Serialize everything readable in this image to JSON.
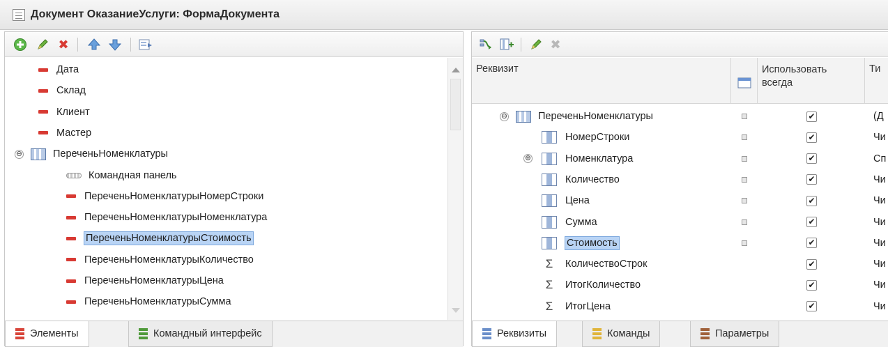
{
  "window": {
    "title": "Документ ОказаниеУслуги: ФормаДокумента"
  },
  "left": {
    "toolbar": [
      "add-icon",
      "edit-icon",
      "delete-icon",
      "move-up-icon",
      "move-down-icon",
      "form-icon"
    ],
    "items": [
      {
        "label": "Дата",
        "kind": "field",
        "level": 1
      },
      {
        "label": "Склад",
        "kind": "field",
        "level": 1
      },
      {
        "label": "Клиент",
        "kind": "field",
        "level": 1
      },
      {
        "label": "Мастер",
        "kind": "field",
        "level": 1
      },
      {
        "label": "ПереченьНоменклатуры",
        "kind": "table",
        "level": 0,
        "expander": "⊖"
      },
      {
        "label": "Командная панель",
        "kind": "command",
        "level": 2
      },
      {
        "label": "ПереченьНоменклатурыНомерСтроки",
        "kind": "field",
        "level": 2
      },
      {
        "label": "ПереченьНоменклатурыНоменклатура",
        "kind": "field",
        "level": 2
      },
      {
        "label": "ПереченьНоменклатурыСтоимость",
        "kind": "field",
        "level": 2,
        "selected": true
      },
      {
        "label": "ПереченьНоменклатурыКоличество",
        "kind": "field",
        "level": 2
      },
      {
        "label": "ПереченьНоменклатурыЦена",
        "kind": "field",
        "level": 2
      },
      {
        "label": "ПереченьНоменклатурыСумма",
        "kind": "field",
        "level": 2
      }
    ],
    "tabs": [
      {
        "label": "Элементы",
        "active": true,
        "color": "#d8453a"
      },
      {
        "label": "Командный интерфейс",
        "active": false,
        "color": "#4f9a3a"
      }
    ]
  },
  "right": {
    "toolbar": [
      "add-attribute-icon",
      "add-column-icon",
      "edit-icon",
      "delete-icon"
    ],
    "headers": {
      "attr": "Реквизит",
      "use_always": "Использовать всегда",
      "type": "Ти"
    },
    "rows": [
      {
        "label": "ПереченьНоменклатуры",
        "kind": "table",
        "expander": "⊖",
        "dot": true,
        "checked": true,
        "type": "(Д"
      },
      {
        "label": "НомерСтроки",
        "kind": "column",
        "dot": true,
        "checked": true,
        "type": "Чи"
      },
      {
        "label": "Номенклатура",
        "kind": "column",
        "expander": "⊕",
        "dot": true,
        "checked": true,
        "type": "Сп"
      },
      {
        "label": "Количество",
        "kind": "column",
        "dot": true,
        "checked": true,
        "type": "Чи"
      },
      {
        "label": "Цена",
        "kind": "column",
        "dot": true,
        "checked": true,
        "type": "Чи"
      },
      {
        "label": "Сумма",
        "kind": "column",
        "dot": true,
        "checked": true,
        "type": "Чи"
      },
      {
        "label": "Стоимость",
        "kind": "column",
        "dot": true,
        "checked": true,
        "type": "Чи",
        "selected": true
      },
      {
        "label": "КоличествоСтрок",
        "kind": "sum",
        "dot": false,
        "checked": true,
        "type": "Чи"
      },
      {
        "label": "ИтогКоличество",
        "kind": "sum",
        "dot": false,
        "checked": true,
        "type": "Чи"
      },
      {
        "label": "ИтогЦена",
        "kind": "sum",
        "dot": false,
        "checked": true,
        "type": "Чи"
      }
    ],
    "tabs": [
      {
        "label": "Реквизиты",
        "active": true,
        "color": "#6b8fc9"
      },
      {
        "label": "Команды",
        "active": false,
        "color": "#e0b43a"
      },
      {
        "label": "Параметры",
        "active": false,
        "color": "#a0613a"
      }
    ]
  },
  "check_mark": "✔"
}
